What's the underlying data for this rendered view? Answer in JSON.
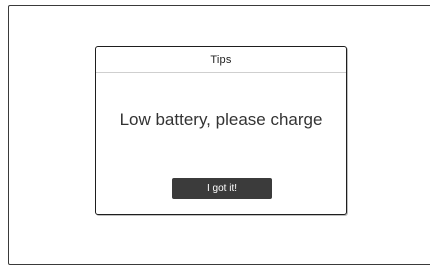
{
  "dialog": {
    "title": "Tips",
    "message": "Low battery, please charge",
    "confirm_label": "I got it!"
  },
  "colors": {
    "button_background": "#3b3b3b",
    "button_text": "#ffffff",
    "border": "#1e1e1e"
  }
}
